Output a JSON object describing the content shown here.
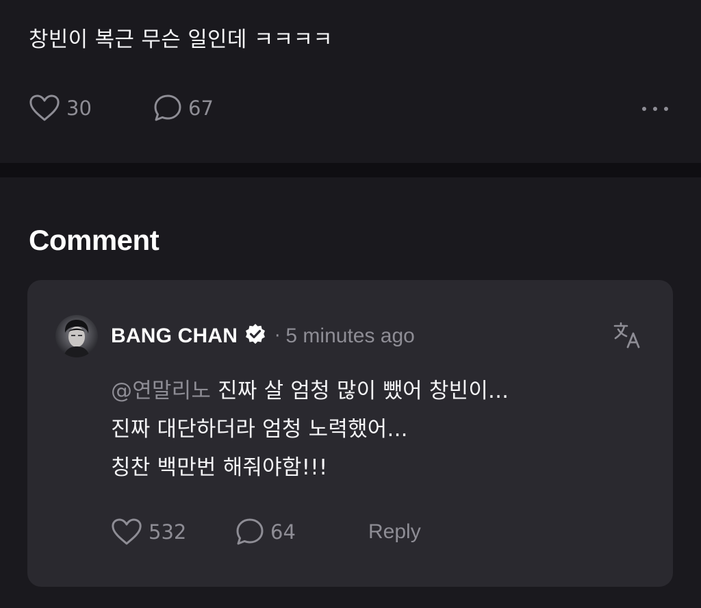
{
  "post": {
    "text": "창빈이 복근 무슨 일인데 ㅋㅋㅋㅋ",
    "likes": "30",
    "comments": "67"
  },
  "section_title": "Comment",
  "comment": {
    "author": "BANG CHAN",
    "separator": "·",
    "timestamp": "5 minutes ago",
    "mention": "@연말리노",
    "line1_text": " 진짜 살 엄청 많이 뺐어 창빈이...",
    "line2_text": "진짜 대단하더라 엄청 노력했어...",
    "line3_text": "칭찬 백만번 해줘야함!!!",
    "likes": "532",
    "replies": "64",
    "reply_label": "Reply"
  },
  "icons": {
    "like": "heart-outline-icon",
    "comment": "speech-bubble-icon",
    "more": "more-horizontal-icon",
    "verified": "verified-badge-icon",
    "translate": "translate-icon"
  },
  "colors": {
    "background": "#1a191e",
    "divider": "#0f0e12",
    "card": "#2a292f",
    "text": "#f4f4f6",
    "muted": "#8e8d95"
  }
}
